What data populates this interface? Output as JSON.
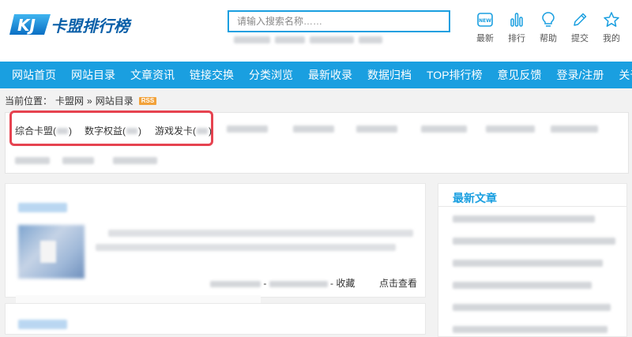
{
  "header": {
    "logo_text": "卡盟排行榜",
    "search_placeholder": "请输入搜索名称……",
    "tools": [
      {
        "icon": "new-icon",
        "label": "最新"
      },
      {
        "icon": "bar-chart-icon",
        "label": "排行"
      },
      {
        "icon": "lightbulb-icon",
        "label": "帮助"
      },
      {
        "icon": "pencil-icon",
        "label": "提交"
      },
      {
        "icon": "star-icon",
        "label": "我的"
      }
    ]
  },
  "nav": [
    "网站首页",
    "网站目录",
    "文章资讯",
    "链接交换",
    "分类浏览",
    "最新收录",
    "数据归档",
    "TOP排行榜",
    "意见反馈",
    "登录/注册",
    "关于我们"
  ],
  "breadcrumb": {
    "prefix": "当前位置：",
    "home": "卡盟网",
    "separator": "»",
    "current": "网站目录",
    "rss": "RSS"
  },
  "categories": {
    "highlighted": [
      "综合卡盟(",
      "数字权益(",
      "游戏发卡("
    ],
    "close": ")"
  },
  "listing": {
    "action_separator": "-",
    "collect_label": "收藏",
    "view_label": "点击查看"
  },
  "sidebar": {
    "title": "最新文章"
  },
  "colors": {
    "brand_blue": "#1a9fe0",
    "highlight_red": "#e64350",
    "rss_orange": "#f2a23a"
  }
}
